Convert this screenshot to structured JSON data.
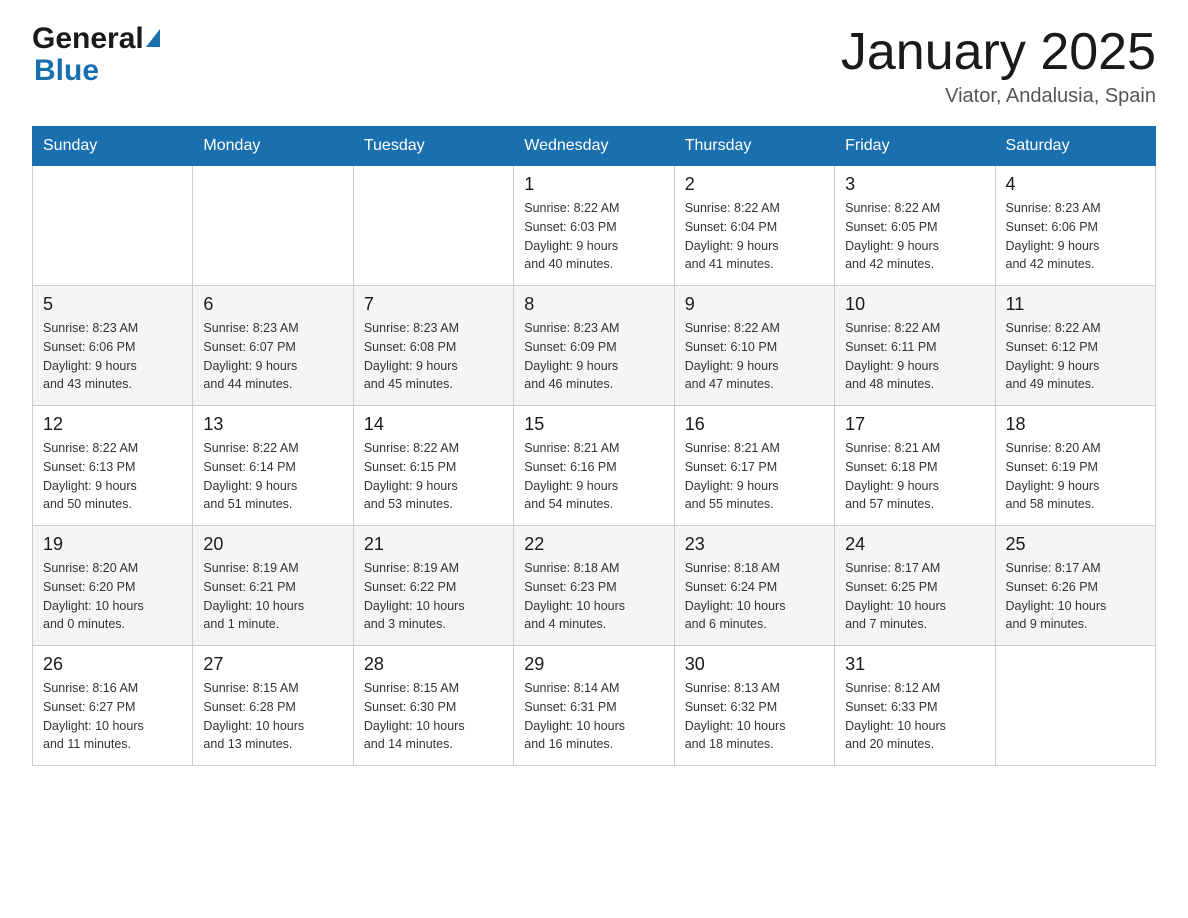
{
  "header": {
    "title": "January 2025",
    "subtitle": "Viator, Andalusia, Spain",
    "logo_general": "General",
    "logo_blue": "Blue"
  },
  "calendar": {
    "days_of_week": [
      "Sunday",
      "Monday",
      "Tuesday",
      "Wednesday",
      "Thursday",
      "Friday",
      "Saturday"
    ],
    "weeks": [
      [
        {
          "day": "",
          "info": ""
        },
        {
          "day": "",
          "info": ""
        },
        {
          "day": "",
          "info": ""
        },
        {
          "day": "1",
          "info": "Sunrise: 8:22 AM\nSunset: 6:03 PM\nDaylight: 9 hours\nand 40 minutes."
        },
        {
          "day": "2",
          "info": "Sunrise: 8:22 AM\nSunset: 6:04 PM\nDaylight: 9 hours\nand 41 minutes."
        },
        {
          "day": "3",
          "info": "Sunrise: 8:22 AM\nSunset: 6:05 PM\nDaylight: 9 hours\nand 42 minutes."
        },
        {
          "day": "4",
          "info": "Sunrise: 8:23 AM\nSunset: 6:06 PM\nDaylight: 9 hours\nand 42 minutes."
        }
      ],
      [
        {
          "day": "5",
          "info": "Sunrise: 8:23 AM\nSunset: 6:06 PM\nDaylight: 9 hours\nand 43 minutes."
        },
        {
          "day": "6",
          "info": "Sunrise: 8:23 AM\nSunset: 6:07 PM\nDaylight: 9 hours\nand 44 minutes."
        },
        {
          "day": "7",
          "info": "Sunrise: 8:23 AM\nSunset: 6:08 PM\nDaylight: 9 hours\nand 45 minutes."
        },
        {
          "day": "8",
          "info": "Sunrise: 8:23 AM\nSunset: 6:09 PM\nDaylight: 9 hours\nand 46 minutes."
        },
        {
          "day": "9",
          "info": "Sunrise: 8:22 AM\nSunset: 6:10 PM\nDaylight: 9 hours\nand 47 minutes."
        },
        {
          "day": "10",
          "info": "Sunrise: 8:22 AM\nSunset: 6:11 PM\nDaylight: 9 hours\nand 48 minutes."
        },
        {
          "day": "11",
          "info": "Sunrise: 8:22 AM\nSunset: 6:12 PM\nDaylight: 9 hours\nand 49 minutes."
        }
      ],
      [
        {
          "day": "12",
          "info": "Sunrise: 8:22 AM\nSunset: 6:13 PM\nDaylight: 9 hours\nand 50 minutes."
        },
        {
          "day": "13",
          "info": "Sunrise: 8:22 AM\nSunset: 6:14 PM\nDaylight: 9 hours\nand 51 minutes."
        },
        {
          "day": "14",
          "info": "Sunrise: 8:22 AM\nSunset: 6:15 PM\nDaylight: 9 hours\nand 53 minutes."
        },
        {
          "day": "15",
          "info": "Sunrise: 8:21 AM\nSunset: 6:16 PM\nDaylight: 9 hours\nand 54 minutes."
        },
        {
          "day": "16",
          "info": "Sunrise: 8:21 AM\nSunset: 6:17 PM\nDaylight: 9 hours\nand 55 minutes."
        },
        {
          "day": "17",
          "info": "Sunrise: 8:21 AM\nSunset: 6:18 PM\nDaylight: 9 hours\nand 57 minutes."
        },
        {
          "day": "18",
          "info": "Sunrise: 8:20 AM\nSunset: 6:19 PM\nDaylight: 9 hours\nand 58 minutes."
        }
      ],
      [
        {
          "day": "19",
          "info": "Sunrise: 8:20 AM\nSunset: 6:20 PM\nDaylight: 10 hours\nand 0 minutes."
        },
        {
          "day": "20",
          "info": "Sunrise: 8:19 AM\nSunset: 6:21 PM\nDaylight: 10 hours\nand 1 minute."
        },
        {
          "day": "21",
          "info": "Sunrise: 8:19 AM\nSunset: 6:22 PM\nDaylight: 10 hours\nand 3 minutes."
        },
        {
          "day": "22",
          "info": "Sunrise: 8:18 AM\nSunset: 6:23 PM\nDaylight: 10 hours\nand 4 minutes."
        },
        {
          "day": "23",
          "info": "Sunrise: 8:18 AM\nSunset: 6:24 PM\nDaylight: 10 hours\nand 6 minutes."
        },
        {
          "day": "24",
          "info": "Sunrise: 8:17 AM\nSunset: 6:25 PM\nDaylight: 10 hours\nand 7 minutes."
        },
        {
          "day": "25",
          "info": "Sunrise: 8:17 AM\nSunset: 6:26 PM\nDaylight: 10 hours\nand 9 minutes."
        }
      ],
      [
        {
          "day": "26",
          "info": "Sunrise: 8:16 AM\nSunset: 6:27 PM\nDaylight: 10 hours\nand 11 minutes."
        },
        {
          "day": "27",
          "info": "Sunrise: 8:15 AM\nSunset: 6:28 PM\nDaylight: 10 hours\nand 13 minutes."
        },
        {
          "day": "28",
          "info": "Sunrise: 8:15 AM\nSunset: 6:30 PM\nDaylight: 10 hours\nand 14 minutes."
        },
        {
          "day": "29",
          "info": "Sunrise: 8:14 AM\nSunset: 6:31 PM\nDaylight: 10 hours\nand 16 minutes."
        },
        {
          "day": "30",
          "info": "Sunrise: 8:13 AM\nSunset: 6:32 PM\nDaylight: 10 hours\nand 18 minutes."
        },
        {
          "day": "31",
          "info": "Sunrise: 8:12 AM\nSunset: 6:33 PM\nDaylight: 10 hours\nand 20 minutes."
        },
        {
          "day": "",
          "info": ""
        }
      ]
    ]
  }
}
